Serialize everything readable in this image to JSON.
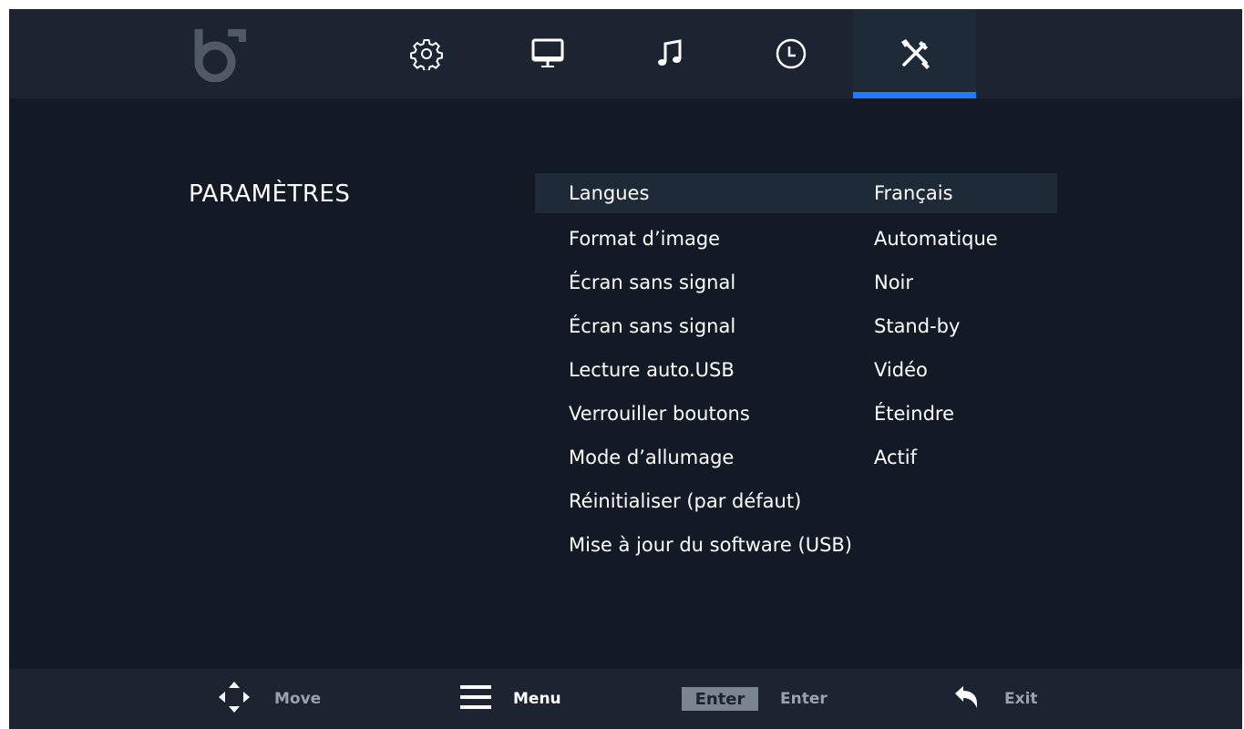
{
  "header": {
    "tabs": [
      {
        "icon": "gear-icon",
        "active": false
      },
      {
        "icon": "monitor-icon",
        "active": false
      },
      {
        "icon": "music-note-icon",
        "active": false
      },
      {
        "icon": "clock-icon",
        "active": false
      },
      {
        "icon": "tools-icon",
        "active": true
      }
    ],
    "accent_color": "#1f7bff"
  },
  "section": {
    "title": "PARAMÈTRES"
  },
  "menu": {
    "items": [
      {
        "label": "Langues",
        "value": "Français",
        "selected": true
      },
      {
        "label": "Format d’image",
        "value": "Automatique"
      },
      {
        "label": "Écran sans signal",
        "value": "Noir"
      },
      {
        "label": "Écran sans signal",
        "value": "Stand-by"
      },
      {
        "label": "Lecture auto.USB",
        "value": "Vidéo"
      },
      {
        "label": "Verrouiller boutons",
        "value": "Éteindre"
      },
      {
        "label": "Mode d’allumage",
        "value": "Actif"
      },
      {
        "label": "Réinitialiser (par défaut)",
        "value": ""
      },
      {
        "label": "Mise à jour du software (USB)",
        "value": ""
      }
    ]
  },
  "footer": {
    "move_label": "Move",
    "menu_label": "Menu",
    "enter_key": "Enter",
    "enter_label": "Enter",
    "exit_label": "Exit"
  }
}
